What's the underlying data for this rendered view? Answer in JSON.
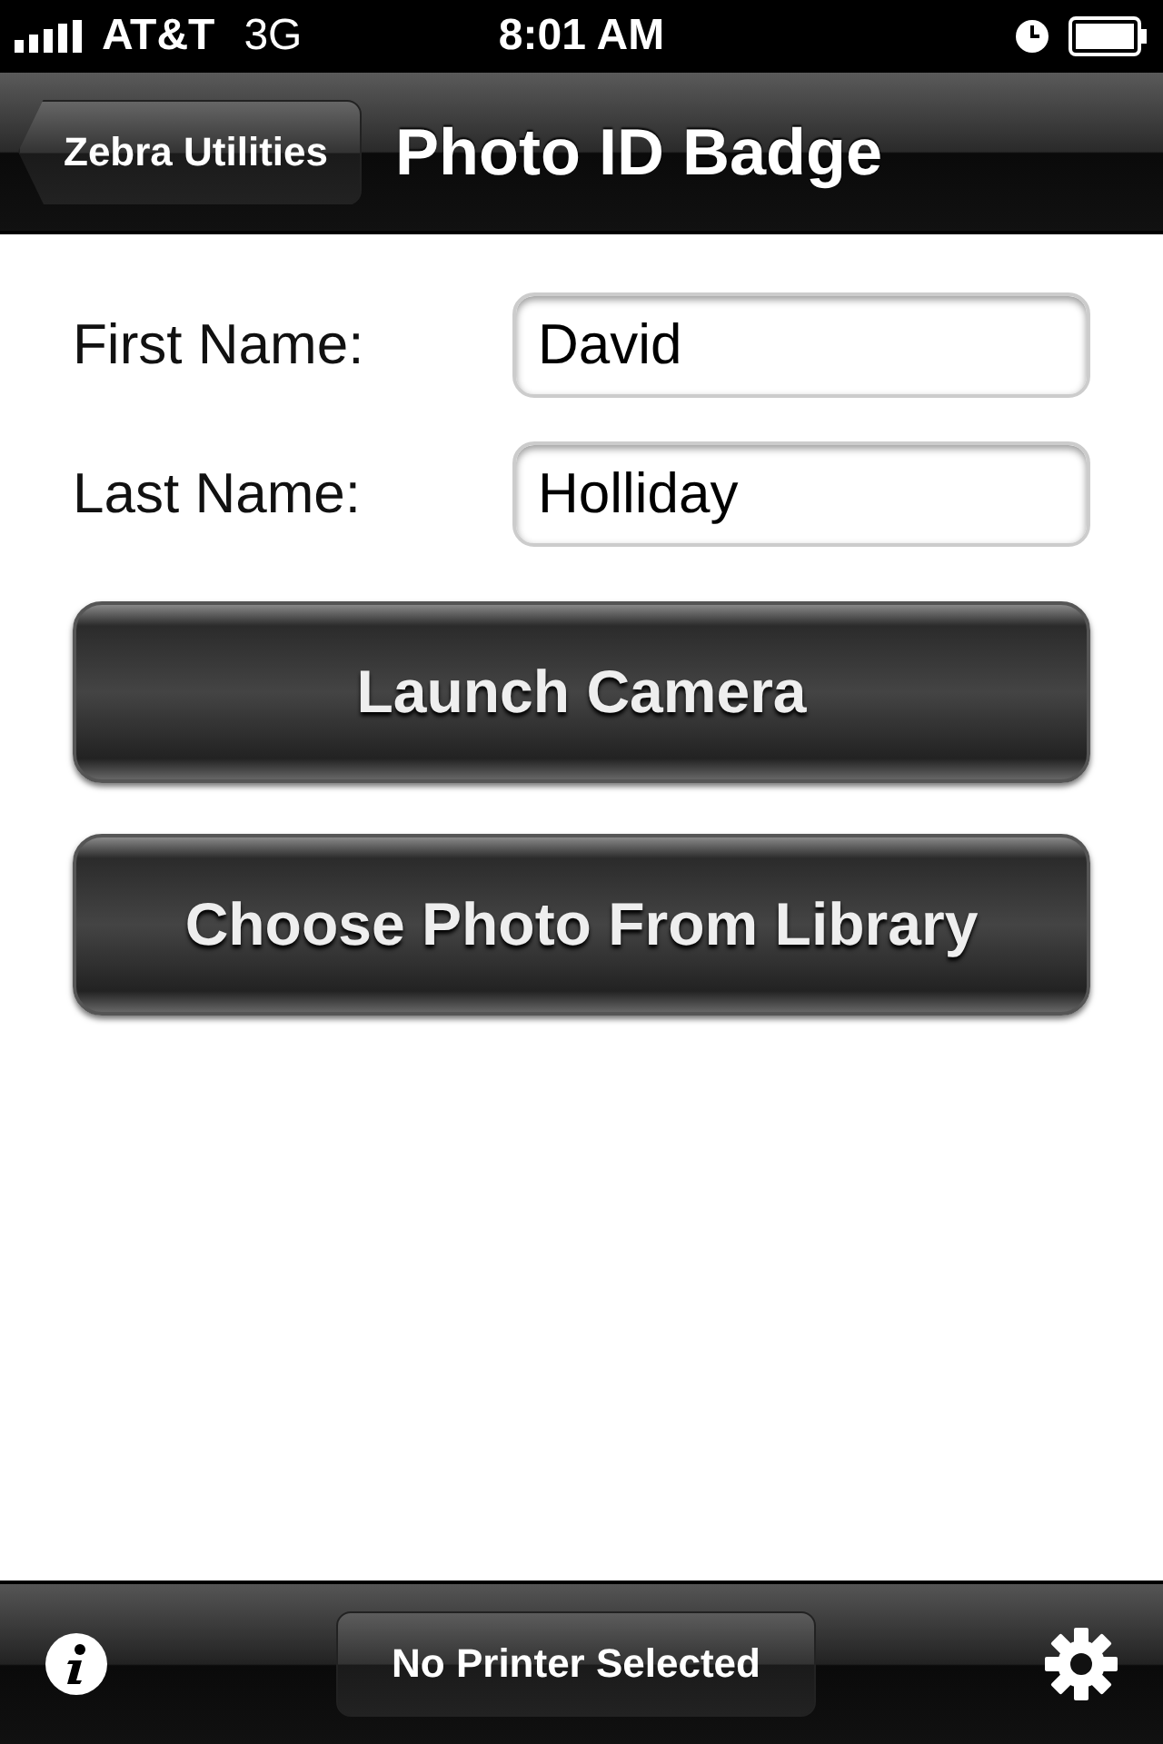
{
  "status_bar": {
    "carrier": "AT&T",
    "network": "3G",
    "time": "8:01 AM"
  },
  "nav_bar": {
    "back_button": "Zebra Utilities",
    "title": "Photo ID Badge"
  },
  "form": {
    "fields": [
      {
        "label": "First Name:",
        "value": "David"
      },
      {
        "label": "Last Name:",
        "value": "Holliday"
      }
    ]
  },
  "buttons": [
    "Launch Camera",
    "Choose Photo From Library"
  ],
  "toolbar": {
    "printer_button": "No Printer Selected"
  }
}
